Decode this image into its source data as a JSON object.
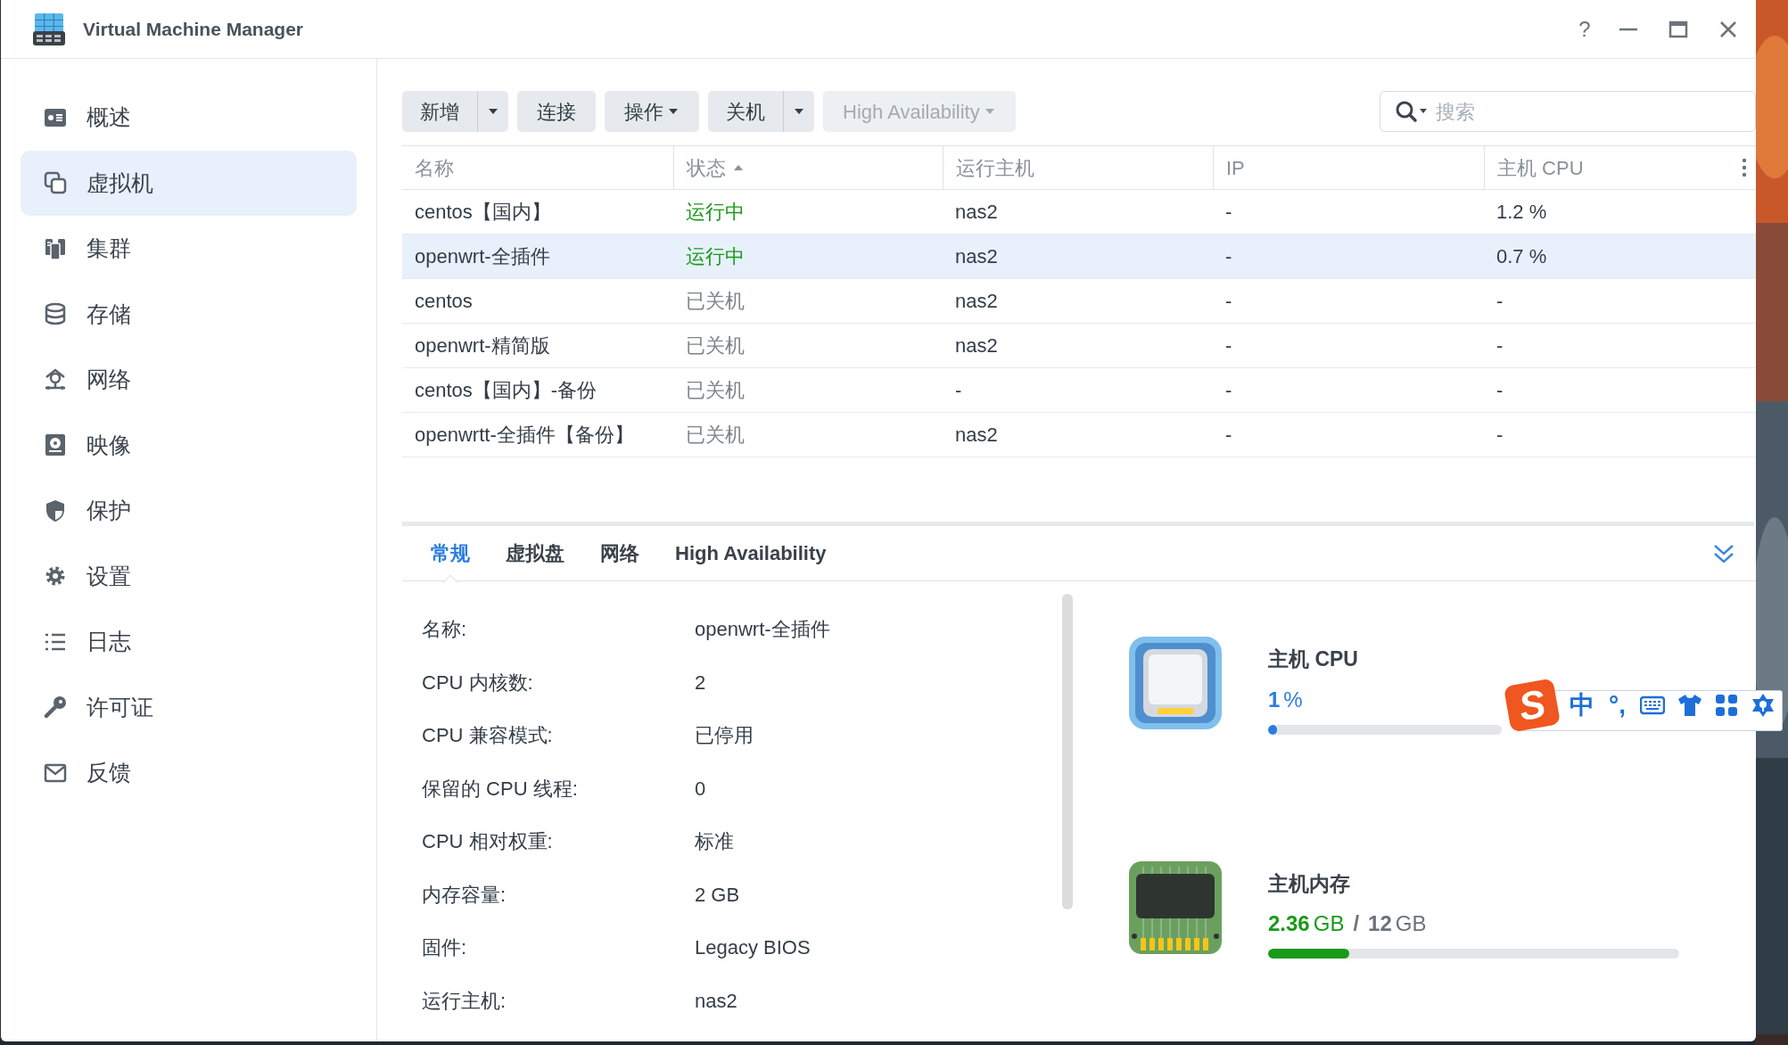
{
  "window": {
    "title": "Virtual Machine Manager",
    "help": "?"
  },
  "sidebar": {
    "items": [
      {
        "label": "概述",
        "selected": false
      },
      {
        "label": "虚拟机",
        "selected": true
      },
      {
        "label": "集群",
        "selected": false
      },
      {
        "label": "存储",
        "selected": false
      },
      {
        "label": "网络",
        "selected": false
      },
      {
        "label": "映像",
        "selected": false
      },
      {
        "label": "保护",
        "selected": false
      },
      {
        "label": "设置",
        "selected": false
      },
      {
        "label": "日志",
        "selected": false
      },
      {
        "label": "许可证",
        "selected": false
      },
      {
        "label": "反馈",
        "selected": false
      }
    ]
  },
  "toolbar": {
    "buttons": [
      {
        "label": "新增",
        "kind": "split",
        "disabled": false
      },
      {
        "label": "连接",
        "kind": "plain",
        "disabled": false
      },
      {
        "label": "操作",
        "kind": "menu",
        "disabled": false
      },
      {
        "label": "关机",
        "kind": "split",
        "disabled": false
      },
      {
        "label": "High Availability",
        "kind": "menu",
        "disabled": true
      }
    ]
  },
  "search": {
    "placeholder": "搜索"
  },
  "table": {
    "columns": [
      {
        "label": "名称",
        "sorted": false
      },
      {
        "label": "状态",
        "sorted": true
      },
      {
        "label": "运行主机",
        "sorted": false
      },
      {
        "label": "IP",
        "sorted": false
      },
      {
        "label": "主机 CPU",
        "sorted": false
      }
    ],
    "rows": [
      {
        "cells": [
          "centos【国内】",
          "运行中",
          "nas2",
          "-",
          "1.2 %"
        ],
        "running": true,
        "selected": false
      },
      {
        "cells": [
          "openwrt-全插件",
          "运行中",
          "nas2",
          "-",
          "0.7 %"
        ],
        "running": true,
        "selected": true
      },
      {
        "cells": [
          "centos",
          "已关机",
          "nas2",
          "-",
          "-"
        ],
        "running": false,
        "selected": false
      },
      {
        "cells": [
          "openwrt-精简版",
          "已关机",
          "nas2",
          "-",
          "-"
        ],
        "running": false,
        "selected": false
      },
      {
        "cells": [
          "centos【国内】-备份",
          "已关机",
          "-",
          "-",
          "-"
        ],
        "running": false,
        "selected": false
      },
      {
        "cells": [
          "openwrtt-全插件【备份】",
          "已关机",
          "nas2",
          "-",
          "-"
        ],
        "running": false,
        "selected": false
      }
    ]
  },
  "detail_tabs": [
    {
      "label": "常规",
      "selected": true
    },
    {
      "label": "虚拟盘",
      "selected": false
    },
    {
      "label": "网络",
      "selected": false
    },
    {
      "label": "High Availability",
      "selected": false
    }
  ],
  "details": [
    {
      "label": "名称:",
      "value": "openwrt-全插件"
    },
    {
      "label": "CPU 内核数:",
      "value": "2"
    },
    {
      "label": "CPU 兼容模式:",
      "value": "已停用"
    },
    {
      "label": "保留的 CPU 线程:",
      "value": "0"
    },
    {
      "label": "CPU 相对权重:",
      "value": "标准"
    },
    {
      "label": "内存容量:",
      "value": "2 GB"
    },
    {
      "label": "固件:",
      "value": "Legacy BIOS"
    },
    {
      "label": "运行主机:",
      "value": "nas2"
    }
  ],
  "resources": [
    {
      "kind": "cpu",
      "title": "主机 CPU",
      "value": "1",
      "unit": "%",
      "level": 0.01
    },
    {
      "kind": "memory",
      "title": "主机内存",
      "value": "2.36",
      "unit": "GB",
      "separator": "/",
      "total": "12",
      "total_unit": "GB",
      "level": 0.197
    }
  ],
  "ime_toolbar": {
    "logo": "S",
    "mode": "中",
    "punctuation": "°,"
  }
}
